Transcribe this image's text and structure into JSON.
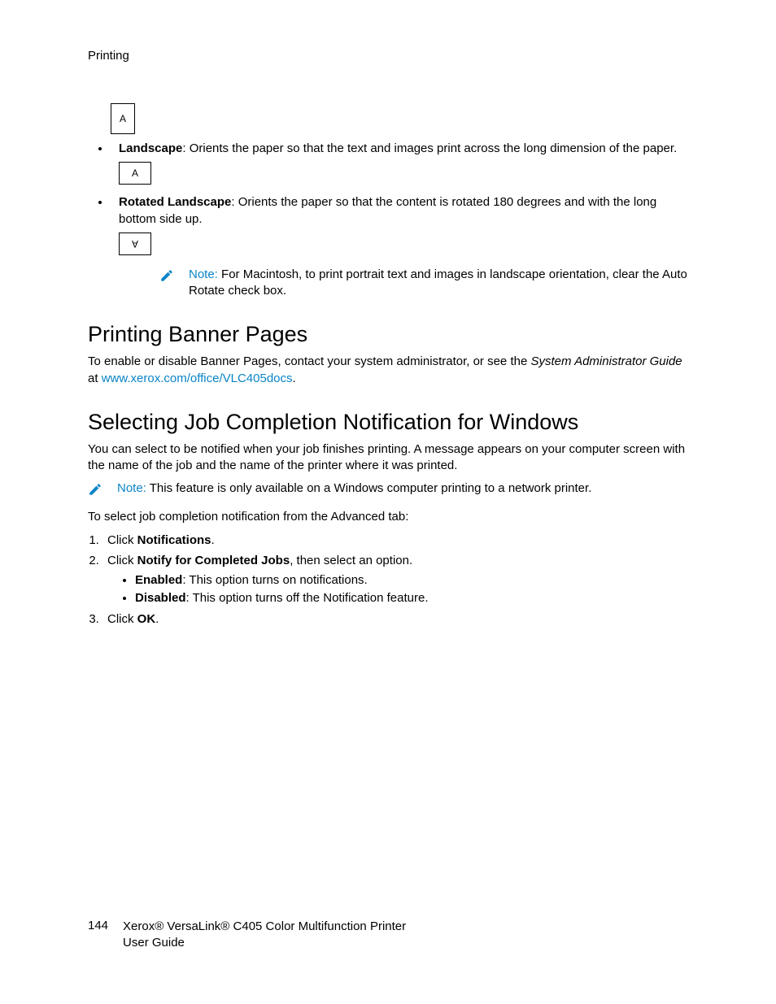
{
  "header": "Printing",
  "orient": {
    "portrait_letter": "A",
    "landscape_letter": "A",
    "rotated_letter": "A"
  },
  "bullets": {
    "landscape_label": "Landscape",
    "landscape_desc": ": Orients the paper so that the text and images print across the long dimension of the paper.",
    "rotated_label": "Rotated Landscape",
    "rotated_desc": ": Orients the paper so that the content is rotated 180 degrees and with the long bottom side up."
  },
  "note1": {
    "label": "Note:",
    "text": " For Macintosh, to print portrait text and images in landscape orientation, clear the Auto Rotate check box."
  },
  "banner": {
    "heading": "Printing Banner Pages",
    "p1a": "To enable or disable Banner Pages, contact your system administrator, or see the ",
    "p1b": "System Administrator Guide",
    "p1c": " at ",
    "link": "www.xerox.com/office/VLC405docs",
    "p1d": "."
  },
  "jobnotif": {
    "heading": "Selecting Job Completion Notification for Windows",
    "p1": "You can select to be notified when your job finishes printing. A message appears on your computer screen with the name of the job and the name of the printer where it was printed.",
    "note_label": "Note:",
    "note_text": " This feature is only available on a Windows computer printing to a network printer.",
    "p2": "To select job completion notification from the Advanced tab:",
    "step1a": "Click ",
    "step1b": "Notifications",
    "step1c": ".",
    "step2a": "Click ",
    "step2b": "Notify for Completed Jobs",
    "step2c": ", then select an option.",
    "opt_en_label": "Enabled",
    "opt_en_desc": ": This option turns on notifications.",
    "opt_dis_label": "Disabled",
    "opt_dis_desc": ": This option turns off the Notification feature.",
    "step3a": "Click ",
    "step3b": "OK",
    "step3c": "."
  },
  "footer": {
    "page": "144",
    "line1": "Xerox® VersaLink® C405 Color Multifunction Printer",
    "line2": "User Guide"
  }
}
